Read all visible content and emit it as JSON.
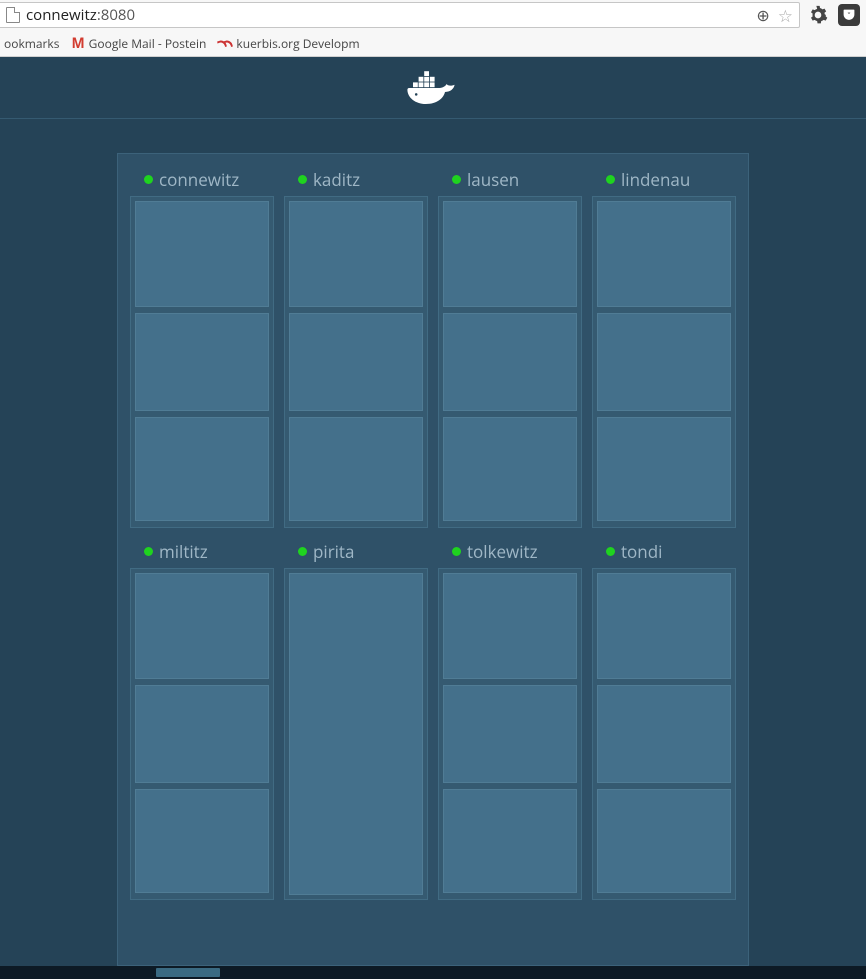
{
  "browser": {
    "url_host": "connewitz",
    "url_port": ":8080",
    "bookmarks_truncated": "ookmarks",
    "bm_gmail": "Google Mail - Postein",
    "bm_kuerbis": "kuerbis.org Developm"
  },
  "nodes": [
    {
      "name": "connewitz",
      "status": "up",
      "services": [
        "tall-top",
        "square",
        "bottom"
      ]
    },
    {
      "name": "kaditz",
      "status": "up",
      "services": [
        "tall-top",
        "square",
        "bottom"
      ]
    },
    {
      "name": "lausen",
      "status": "up",
      "services": [
        "tall-top",
        "square",
        "bottom"
      ]
    },
    {
      "name": "lindenau",
      "status": "up",
      "services": [
        "tall-top",
        "square",
        "bottom"
      ]
    },
    {
      "name": "miltitz",
      "status": "up",
      "services": [
        "tall-top",
        "square",
        "bottom"
      ]
    },
    {
      "name": "pirita",
      "status": "up",
      "services": [
        "fill"
      ]
    },
    {
      "name": "tolkewitz",
      "status": "up",
      "services": [
        "tall-top",
        "square",
        "bottom"
      ]
    },
    {
      "name": "tondi",
      "status": "up",
      "services": [
        "tall-top",
        "square",
        "bottom"
      ]
    }
  ]
}
